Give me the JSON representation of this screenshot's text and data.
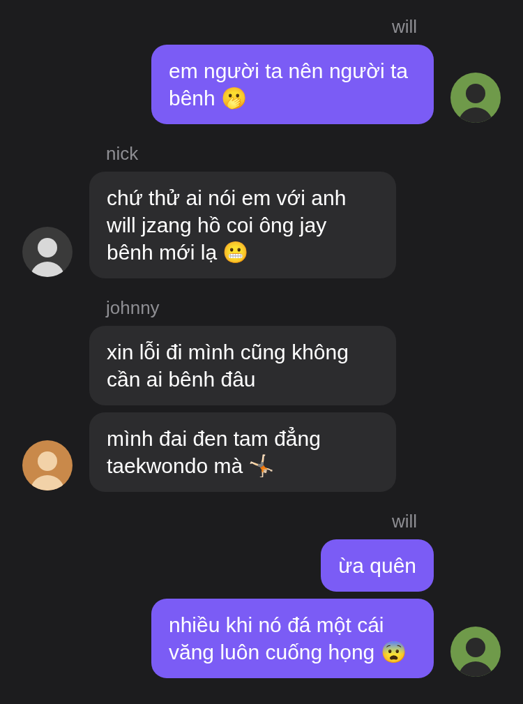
{
  "groups": [
    {
      "sender": "will",
      "kind": "outgoing",
      "messages": [
        "em người ta nên người ta bênh 🫢"
      ]
    },
    {
      "sender": "nick",
      "kind": "incoming",
      "messages": [
        "chứ thử ai nói em với anh will jzang hồ coi ông jay bênh mới lạ 😬"
      ]
    },
    {
      "sender": "johnny",
      "kind": "incoming",
      "messages": [
        "xin lỗi đi mình cũng không cần ai bênh đâu",
        "mình đai đen tam đẳng taekwondo mà 🤸🏻"
      ]
    },
    {
      "sender": "will",
      "kind": "outgoing",
      "messages": [
        "ừa quên",
        "nhiều khi nó đá một cái văng luôn cuống họng 😨"
      ]
    }
  ]
}
